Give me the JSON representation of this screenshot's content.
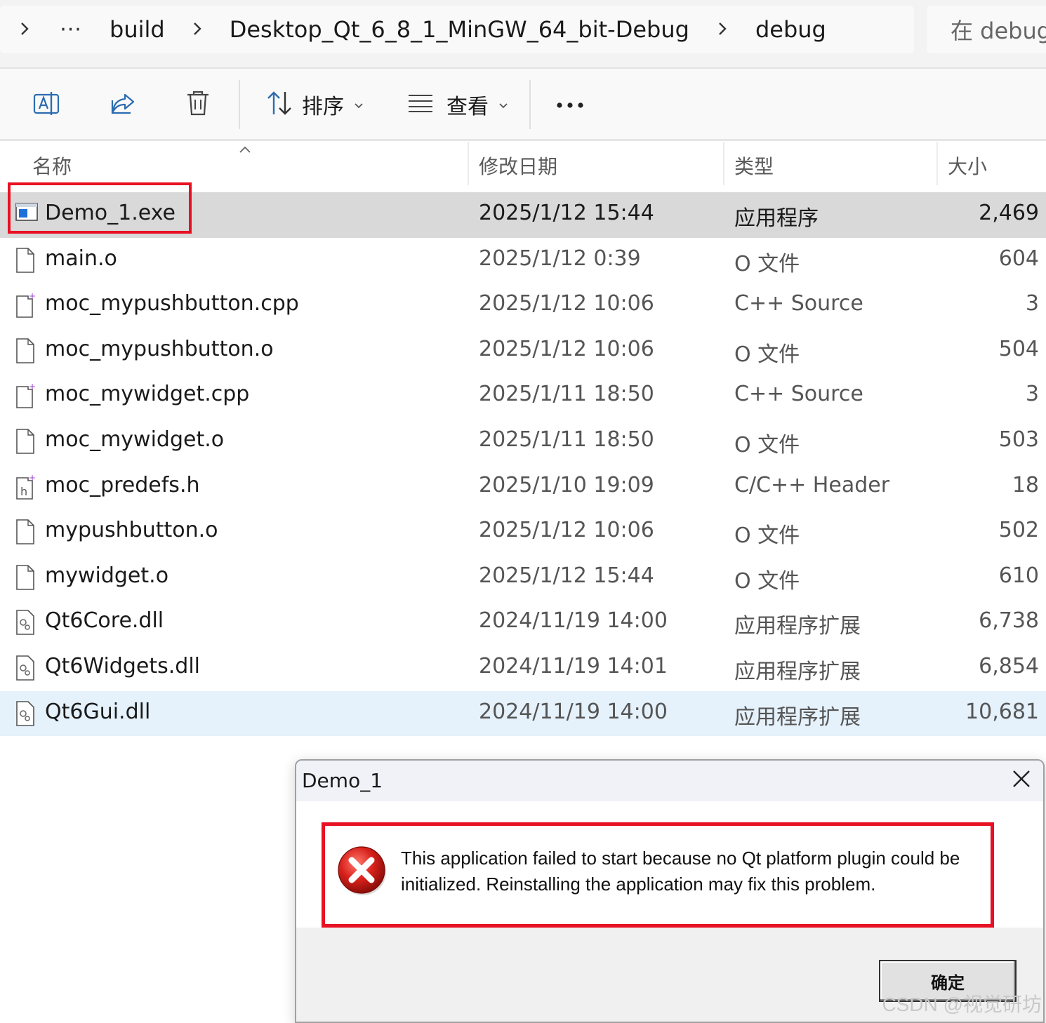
{
  "address_bar": {
    "crumbs": [
      "build",
      "Desktop_Qt_6_8_1_MinGW_64_bit-Debug",
      "debug"
    ],
    "search_placeholder": "在 debug"
  },
  "toolbar": {
    "sort_label": "排序",
    "view_label": "查看"
  },
  "columns": {
    "name": "名称",
    "date": "修改日期",
    "type": "类型",
    "size": "大小"
  },
  "files": [
    {
      "name": "Demo_1.exe",
      "date": "2025/1/12 15:44",
      "type": "应用程序",
      "size": "2,469",
      "icon": "exe-icon"
    },
    {
      "name": "main.o",
      "date": "2025/1/12 0:39",
      "type": "O 文件",
      "size": "604",
      "icon": "file-icon"
    },
    {
      "name": "moc_mypushbutton.cpp",
      "date": "2025/1/12 10:06",
      "type": "C++ Source",
      "size": "3",
      "icon": "cpp-file-icon"
    },
    {
      "name": "moc_mypushbutton.o",
      "date": "2025/1/12 10:06",
      "type": "O 文件",
      "size": "504",
      "icon": "file-icon"
    },
    {
      "name": "moc_mywidget.cpp",
      "date": "2025/1/11 18:50",
      "type": "C++ Source",
      "size": "3",
      "icon": "cpp-file-icon"
    },
    {
      "name": "moc_mywidget.o",
      "date": "2025/1/11 18:50",
      "type": "O 文件",
      "size": "503",
      "icon": "file-icon"
    },
    {
      "name": "moc_predefs.h",
      "date": "2025/1/10 19:09",
      "type": "C/C++ Header",
      "size": "18",
      "icon": "header-file-icon"
    },
    {
      "name": "mypushbutton.o",
      "date": "2025/1/12 10:06",
      "type": "O 文件",
      "size": "502",
      "icon": "file-icon"
    },
    {
      "name": "mywidget.o",
      "date": "2025/1/12 15:44",
      "type": "O 文件",
      "size": "610",
      "icon": "file-icon"
    },
    {
      "name": "Qt6Core.dll",
      "date": "2024/11/19 14:00",
      "type": "应用程序扩展",
      "size": "6,738",
      "icon": "dll-icon"
    },
    {
      "name": "Qt6Widgets.dll",
      "date": "2024/11/19 14:01",
      "type": "应用程序扩展",
      "size": "6,854",
      "icon": "dll-icon"
    },
    {
      "name": "Qt6Gui.dll",
      "date": "2024/11/19 14:00",
      "type": "应用程序扩展",
      "size": "10,681",
      "icon": "dll-icon"
    }
  ],
  "dialog": {
    "title": "Demo_1",
    "message": "This application failed to start because no Qt platform plugin could be initialized. Reinstalling the application may fix this problem.",
    "ok_label": "确定"
  },
  "watermark": "CSDN @视觉研坊"
}
